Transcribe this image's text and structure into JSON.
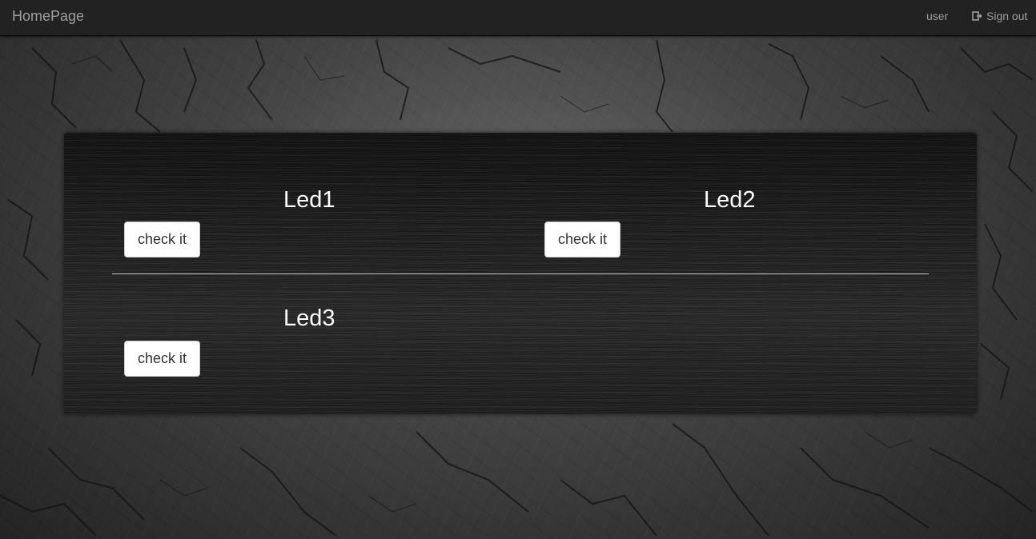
{
  "navbar": {
    "brand": "HomePage",
    "user_label": "user",
    "signout_label": "Sign out",
    "signout_icon": "sign-out-icon"
  },
  "leds": [
    {
      "title": "Led1",
      "button_label": "check it"
    },
    {
      "title": "Led2",
      "button_label": "check it"
    },
    {
      "title": "Led3",
      "button_label": "check it"
    }
  ],
  "colors": {
    "navbar_bg": "#222222",
    "nav_text": "#9d9d9d",
    "title_text": "#ffffff",
    "button_bg": "#ffffff"
  }
}
